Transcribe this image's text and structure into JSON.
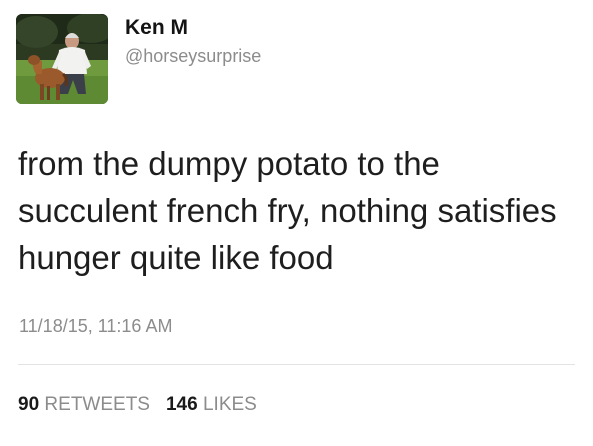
{
  "tweet": {
    "author": {
      "display_name": "Ken M",
      "handle": "@horseysurprise",
      "avatar_icon": "avatar-photo-man-with-pony"
    },
    "text": "from the dumpy potato to the succulent french fry, nothing satisfies hunger quite like food",
    "timestamp": "11/18/15, 11:16 AM",
    "stats": {
      "retweets_count": "90",
      "retweets_label": "RETWEETS",
      "likes_count": "146",
      "likes_label": "LIKES"
    }
  },
  "colors": {
    "primary_text": "#1a1a1a",
    "secondary_text": "#8c8c8c",
    "divider": "#e3e3e3",
    "background": "#ffffff"
  }
}
